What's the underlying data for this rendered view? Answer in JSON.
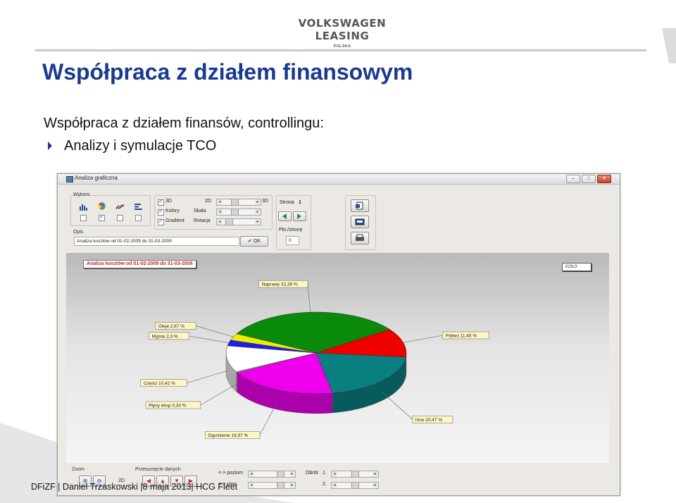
{
  "slide": {
    "brand_name": "VOLKSWAGEN LEASING",
    "brand_sub": "POLSKA",
    "title": "Współpraca z działem finansowym",
    "subhead": "Współpraca z działem finansów, controllingu:",
    "bullet": "Analizy i symulacje TCO",
    "footer": "DFiZF | Daniel Trzaskowski |8 maja 2013| HCG Fleet",
    "accent_color": "#1a3a8f"
  },
  "window": {
    "title": "Analiza graficzna",
    "controls": [
      "–",
      "□",
      "✕"
    ],
    "chart_group": {
      "label": "Wykres",
      "icons": [
        "bar-chart-icon",
        "pie-chart-icon",
        "line-chart-icon",
        "horizontal-bar-icon"
      ],
      "checked": [
        false,
        true,
        false,
        false
      ]
    },
    "options": {
      "cb_3d_label": "3D",
      "cb_colors_label": "Kolory",
      "cb_gradient_label": "Gradient",
      "left_2d": "2D",
      "right_3d": "3D",
      "scale_label": "Skala",
      "rotation_label": "Rotacja"
    },
    "page": {
      "label": "Strona",
      "value": "1",
      "pts_label": "Pkt./stronę",
      "pts_value": "0"
    },
    "description": {
      "label": "Opis",
      "value": "Analiza kosztów od 01-02-2009 do 31-03-2009",
      "ok_label": "OK"
    },
    "toolbar_icons": [
      "export-icon",
      "print-preview-icon",
      "print-icon"
    ]
  },
  "chart_data": {
    "type": "pie",
    "title": "Analiza kosztów od 01-02-2009 do 31-03-2009",
    "legend_label": "KOŁO",
    "three_d": true,
    "slices": [
      {
        "label": "Naprawy",
        "value": 32.39,
        "color": "#0a8a0a"
      },
      {
        "label": "Paliwo",
        "value": 11.45,
        "color": "#ee0000"
      },
      {
        "label": "Inne",
        "value": 20.47,
        "color": "#0a7f80"
      },
      {
        "label": "Ogumienie",
        "value": 19.97,
        "color": "#ee00ee"
      },
      {
        "label": "Płyny eksp",
        "value": 0.33,
        "color": "#d8d8d8"
      },
      {
        "label": "Części",
        "value": 10.42,
        "color": "#ffffff"
      },
      {
        "label": "Myjnia",
        "value": 2.3,
        "color": "#1d1dee"
      },
      {
        "label": "Oleje",
        "value": 2.67,
        "color": "#eeee00"
      }
    ],
    "data_labels": [
      "Naprawy 32,39 %",
      "Paliwo 11,45 %",
      "Inne 20,47 %",
      "Ogumienie 19,97 %",
      "Płyny eksp 0,33 %",
      "Części 10,42 %",
      "Myjnia 2,3 %",
      "Oleje 2,67 %"
    ]
  },
  "bottom": {
    "zoom_label": "Zoom",
    "zoom_mode": "2D",
    "shift_label": "Przesunięcie danych",
    "horizontal_label": "<-> poziom",
    "vertical_label": "<-> pion",
    "axis_label": "Obrót",
    "axis_1": "1.",
    "axis_2": "2."
  }
}
